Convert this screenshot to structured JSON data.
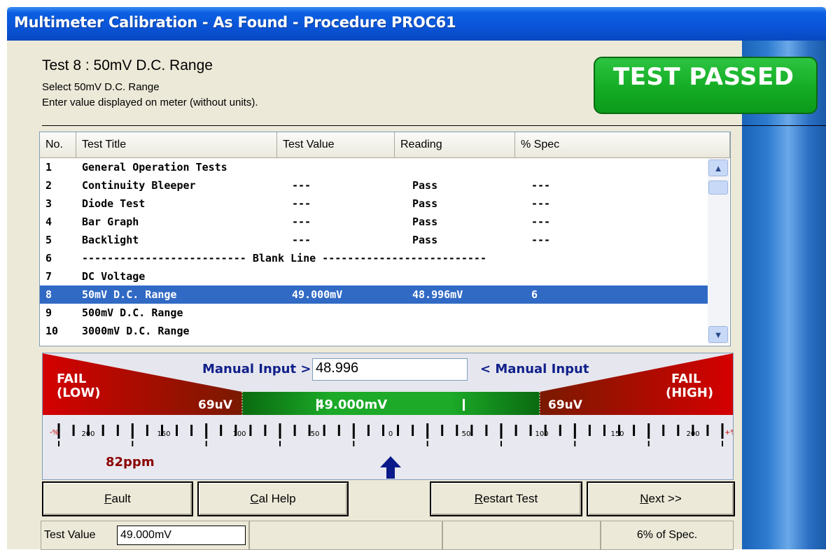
{
  "window": {
    "title": "Multimeter Calibration - As Found - Procedure PROC61"
  },
  "header": {
    "test_title": "Test 8 : 50mV D.C. Range",
    "instruction1": "Select 50mV D.C. Range",
    "instruction2": "Enter value displayed on meter (without units).",
    "result_badge": "TEST PASSED",
    "result_color": "#13aa22"
  },
  "table": {
    "columns": [
      "No.",
      "Test Title",
      "Test Value",
      "Reading",
      "% Spec"
    ],
    "rows": [
      {
        "no": "1",
        "title": "General Operation Tests",
        "value": "",
        "reading": "",
        "spec": ""
      },
      {
        "no": "2",
        "title": "Continuity Bleeper",
        "value": "---",
        "reading": "Pass",
        "spec": "---"
      },
      {
        "no": "3",
        "title": "Diode Test",
        "value": "---",
        "reading": "Pass",
        "spec": "---"
      },
      {
        "no": "4",
        "title": "Bar Graph",
        "value": "---",
        "reading": "Pass",
        "spec": "---"
      },
      {
        "no": "5",
        "title": "Backlight",
        "value": "---",
        "reading": "Pass",
        "spec": "---"
      },
      {
        "no": "6",
        "title": "-------------------------- Blank Line --------------------------",
        "value": "",
        "reading": "",
        "spec": ""
      },
      {
        "no": "7",
        "title": "DC Voltage",
        "value": "",
        "reading": "",
        "spec": ""
      },
      {
        "no": "8",
        "title": "50mV D.C. Range",
        "value": "49.000mV",
        "reading": "48.996mV",
        "spec": "6",
        "selected": true
      },
      {
        "no": "9",
        "title": "500mV D.C. Range",
        "value": "",
        "reading": "",
        "spec": ""
      },
      {
        "no": "10",
        "title": "3000mV D.C. Range",
        "value": "",
        "reading": "",
        "spec": ""
      }
    ]
  },
  "gauge": {
    "fail_low": "FAIL",
    "fail_low2": "(LOW)",
    "fail_high": "FAIL",
    "fail_high2": "(HIGH)",
    "manual_left": "Manual Input >",
    "manual_right": "< Manual Input",
    "input_value": "48.996",
    "tolerance_left": "69uV",
    "tolerance_right": "69uV",
    "center_value": "49.000mV",
    "ppm": "82ppm",
    "scale_labels": [
      "200",
      "150",
      "100",
      "50",
      "0",
      "50",
      "100",
      "150",
      "200"
    ],
    "end_left": "-%",
    "end_right": "+%",
    "pointer_percent": 0,
    "colors": {
      "fail": "#c00000",
      "pass": "#14a020"
    }
  },
  "buttons": {
    "fault": {
      "mnemonic": "F",
      "rest": "ault"
    },
    "cal_help": {
      "mnemonic": "C",
      "rest": "al Help"
    },
    "restart": {
      "mnemonic": "R",
      "rest": "estart Test"
    },
    "next": {
      "mnemonic": "N",
      "rest": "ext >>"
    }
  },
  "status": {
    "test_value_label": "Test Value",
    "test_value": "49.000mV",
    "spec": "6% of Spec."
  }
}
